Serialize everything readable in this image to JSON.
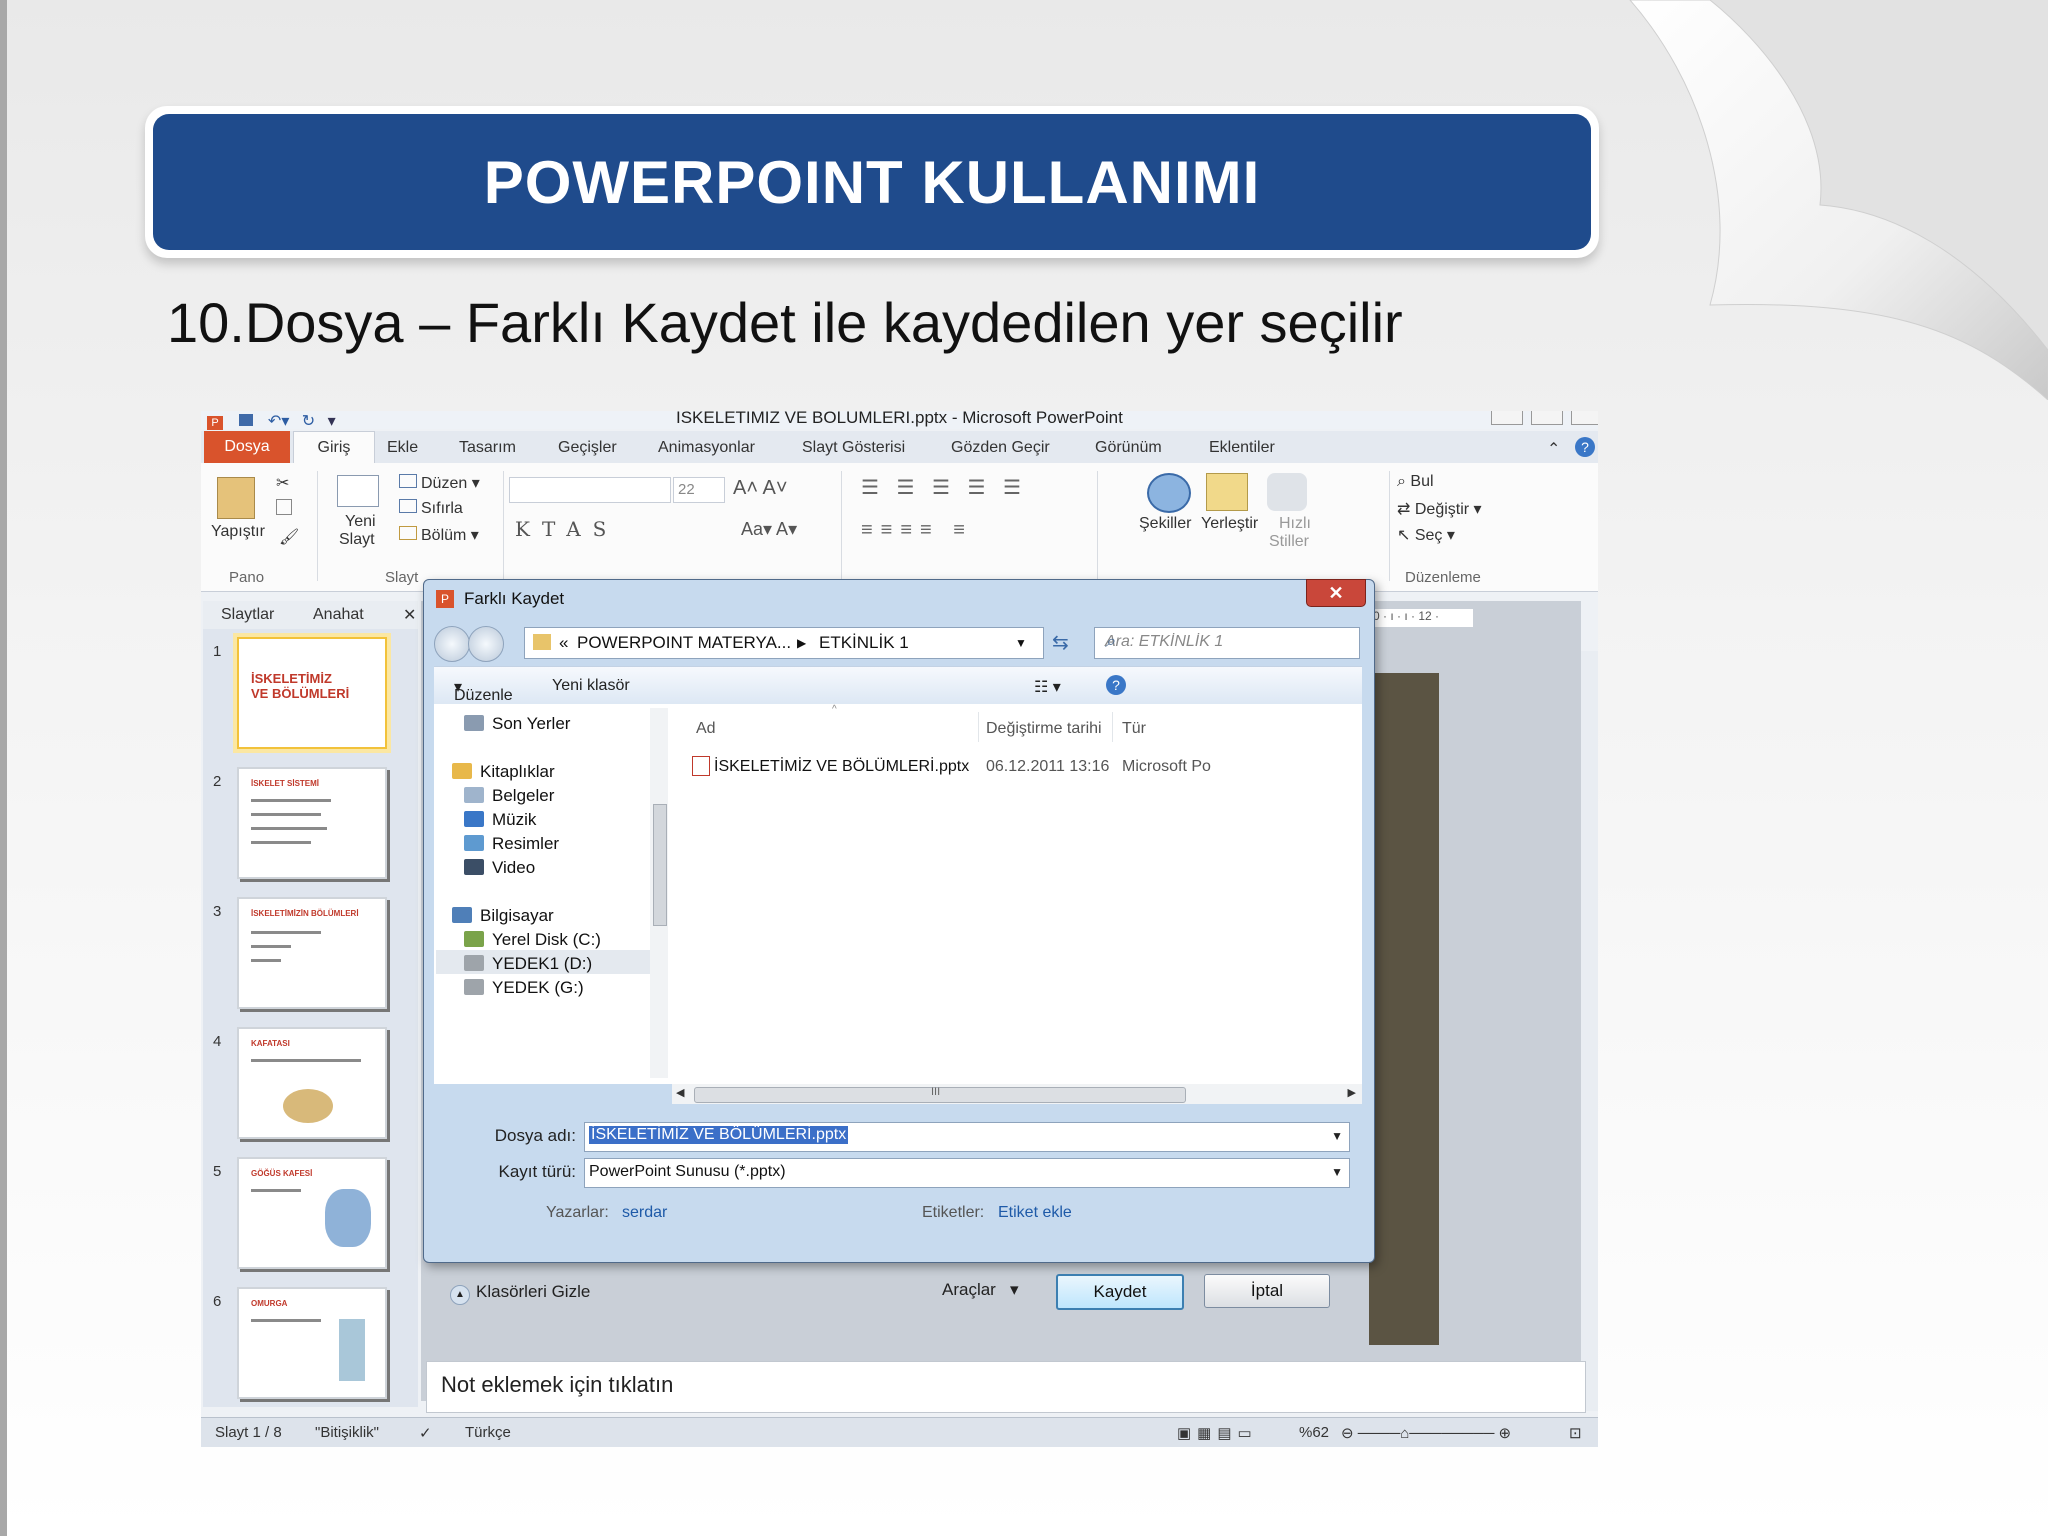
{
  "slide": {
    "title": "POWERPOINT KULLANIMI",
    "subtitle": "10.Dosya – Farklı Kaydet ile kaydedilen yer seçilir"
  },
  "app": {
    "window_title": "İSKELETİMİZ VE BÖLÜMLERİ.pptx - Microsoft PowerPoint",
    "tabs": [
      "Dosya",
      "Giriş",
      "Ekle",
      "Tasarım",
      "Geçişler",
      "Animasyonlar",
      "Slayt Gösterisi",
      "Gözden Geçir",
      "Görünüm",
      "Eklentiler"
    ],
    "ribbon": {
      "paste": "Yapıştır",
      "new_slide_1": "Yeni",
      "new_slide_2": "Slayt",
      "layout": "Düzen",
      "reset": "Sıfırla",
      "section": "Bölüm",
      "font_size": "22",
      "shapes": "Şekiller",
      "arrange": "Yerleştir",
      "quick_styles_1": "Hızlı",
      "quick_styles_2": "Stiller",
      "find": "Bul",
      "replace": "Değiştir",
      "select": "Seç",
      "group_clipboard": "Pano",
      "group_slides": "Slayt",
      "group_editing": "Düzenleme"
    },
    "pane_tabs": [
      "Slaytlar",
      "Anahat"
    ],
    "thumbnails": [
      {
        "num": "1",
        "title": "İSKELETİMİZ VE BÖLÜMLERİ"
      },
      {
        "num": "2",
        "title": "İSKELET SİSTEMİ"
      },
      {
        "num": "3",
        "title": "İSKELETİMİZİN BÖLÜMLERİ"
      },
      {
        "num": "4",
        "title": "KAFATASI"
      },
      {
        "num": "5",
        "title": "GÖĞÜS KAFESİ"
      },
      {
        "num": "6",
        "title": "OMURGA"
      }
    ],
    "ruler_text": "0 · ı · ı · 12 ·",
    "notes_placeholder": "Not eklemek için tıklatın",
    "status": {
      "slide": "Slayt 1 / 8",
      "theme": "\"Bitişiklik\"",
      "language": "Türkçe",
      "zoom": "%62"
    }
  },
  "dialog": {
    "title": "Farklı Kaydet",
    "breadcrumb": [
      "«",
      "POWERPOINT MATERYA...",
      "ETKİNLİK 1"
    ],
    "search_placeholder": "Ara: ETKİNLİK 1",
    "organize": "Düzenle",
    "new_folder": "Yeni klasör",
    "nav": [
      {
        "label": "Son Yerler",
        "icon": "recent-places-icon",
        "color": "#8a9bb0"
      },
      {
        "label": "Kitaplıklar",
        "icon": "libraries-icon",
        "color": "#e8b84a"
      },
      {
        "label": "Belgeler",
        "icon": "documents-icon",
        "color": "#9fb4cc"
      },
      {
        "label": "Müzik",
        "icon": "music-icon",
        "color": "#3a77c7"
      },
      {
        "label": "Resimler",
        "icon": "pictures-icon",
        "color": "#5e9ad0"
      },
      {
        "label": "Video",
        "icon": "video-icon",
        "color": "#3b4e66"
      },
      {
        "label": "Bilgisayar",
        "icon": "computer-icon",
        "color": "#4f7fb8"
      },
      {
        "label": "Yerel Disk (C:)",
        "icon": "local-disk-icon",
        "color": "#7aa34a"
      },
      {
        "label": "YEDEK1 (D:)",
        "icon": "drive-icon",
        "color": "#9ea4aa"
      },
      {
        "label": "YEDEK (G:)",
        "icon": "drive-icon",
        "color": "#9ea4aa"
      }
    ],
    "columns": [
      "Ad",
      "Değiştirme tarihi",
      "Tür"
    ],
    "files": [
      {
        "name": "İSKELETİMİZ VE BÖLÜMLERİ.pptx",
        "modified": "06.12.2011 13:16",
        "type": "Microsoft Po"
      }
    ],
    "scroll_mark": "III",
    "file_name_label": "Dosya adı:",
    "file_name_value": "İSKELETİMİZ VE BÖLÜMLERİ.pptx",
    "save_type_label": "Kayıt türü:",
    "save_type_value": "PowerPoint Sunusu (*.pptx)",
    "authors_label": "Yazarlar:",
    "authors_value": "serdar",
    "tags_label": "Etiketler:",
    "tags_value": "Etiket ekle",
    "hide_folders": "Klasörleri Gizle",
    "tools": "Araçlar",
    "save": "Kaydet",
    "cancel": "İptal",
    "close": "✕"
  },
  "colors": {
    "banner": "#1f4b8c",
    "file_tab": "#d9532c",
    "selection": "#3b6fc8",
    "link": "#1e5aa8"
  }
}
